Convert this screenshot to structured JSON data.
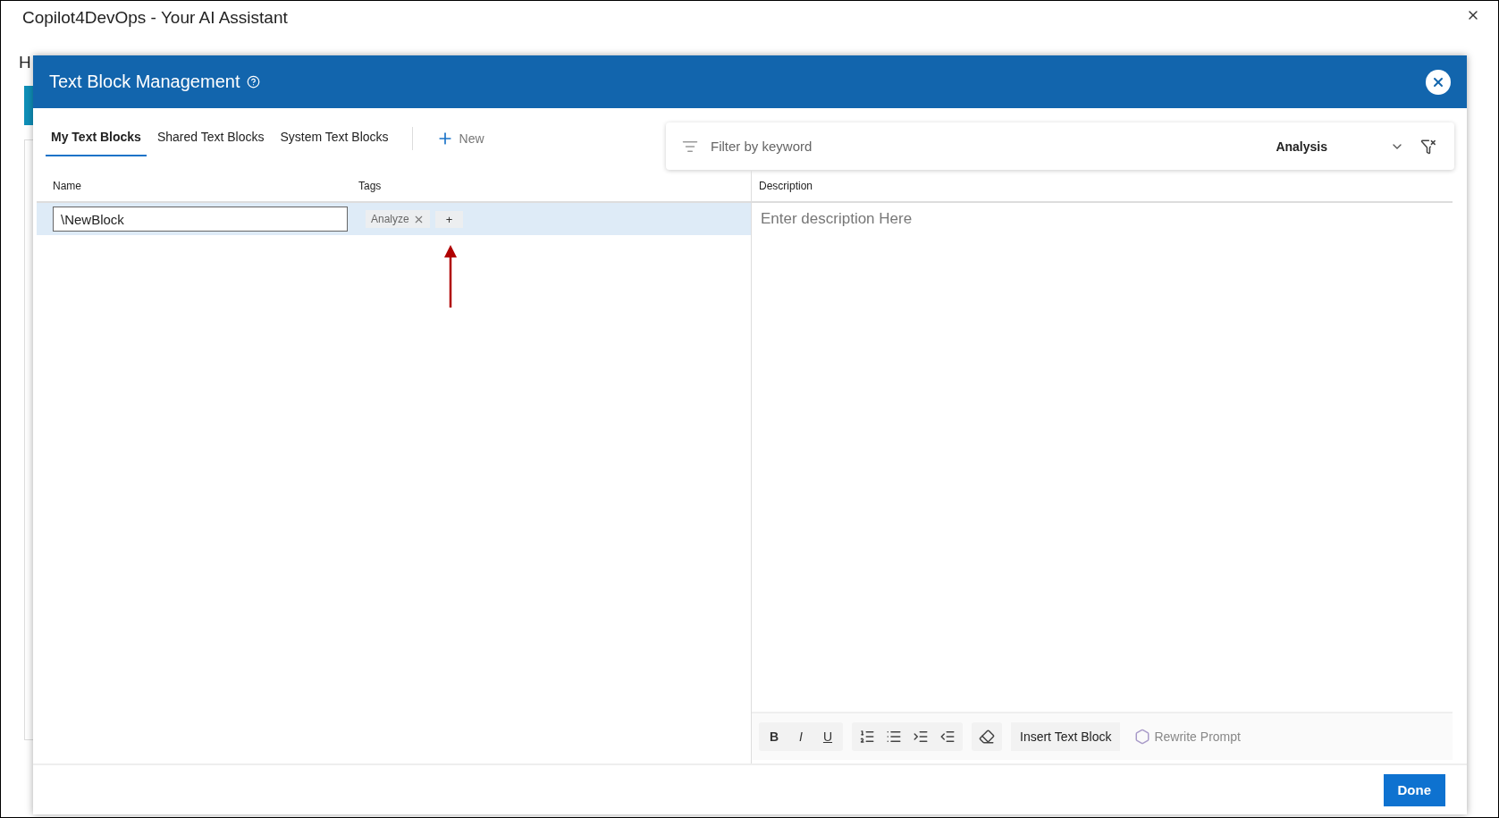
{
  "window": {
    "title": "Copilot4DevOps - Your AI Assistant"
  },
  "background": {
    "heading": "H"
  },
  "dialog": {
    "title": "Text Block Management",
    "tabs": [
      {
        "label": "My Text Blocks",
        "selected": true
      },
      {
        "label": "Shared Text Blocks",
        "selected": false
      },
      {
        "label": "System Text Blocks",
        "selected": false
      }
    ],
    "new_button": "New",
    "filter": {
      "placeholder": "Filter by keyword",
      "category": "Analysis"
    },
    "table": {
      "columns": [
        "Name",
        "Tags"
      ],
      "rows": [
        {
          "name": "\\NewBlock",
          "tags": [
            "Analyze"
          ],
          "add_tag": "+",
          "selected": true
        }
      ]
    },
    "description": {
      "header": "Description",
      "placeholder": "Enter description Here"
    },
    "toolbar": {
      "format_buttons": [
        "B",
        "I",
        "U"
      ],
      "insert_button": "Insert Text Block",
      "rewrite_button": {
        "label": "Rewrite Prompt",
        "disabled": true
      }
    },
    "done_button": "Done"
  }
}
